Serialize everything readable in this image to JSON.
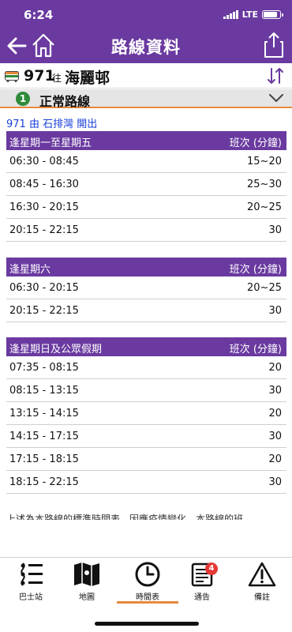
{
  "status_bar": {
    "time": "6:24",
    "network": "LTE"
  },
  "header": {
    "title": "路線資料"
  },
  "route": {
    "number": "971",
    "direction_word": "往",
    "destination": "海麗邨"
  },
  "variant": {
    "number": "1",
    "label": "正常路線"
  },
  "departure": {
    "text": "971 由 石排灣 開出"
  },
  "timetables": [
    {
      "day": "逢星期一至星期五",
      "freq_header": "班次 (分鐘)",
      "rows": [
        {
          "period": "06:30 - 08:45",
          "freq": "15~20"
        },
        {
          "period": "08:45 - 16:30",
          "freq": "25~30"
        },
        {
          "period": "16:30 - 20:15",
          "freq": "20~25"
        },
        {
          "period": "20:15 - 22:15",
          "freq": "30"
        }
      ]
    },
    {
      "day": "逢星期六",
      "freq_header": "班次 (分鐘)",
      "rows": [
        {
          "period": "06:30 - 20:15",
          "freq": "20~25"
        },
        {
          "period": "20:15 - 22:15",
          "freq": "30"
        }
      ]
    },
    {
      "day": "逢星期日及公眾假期",
      "freq_header": "班次 (分鐘)",
      "rows": [
        {
          "period": "07:35 - 08:15",
          "freq": "20"
        },
        {
          "period": "08:15 - 13:15",
          "freq": "30"
        },
        {
          "period": "13:15 - 14:15",
          "freq": "20"
        },
        {
          "period": "14:15 - 17:15",
          "freq": "30"
        },
        {
          "period": "17:15 - 18:15",
          "freq": "20"
        },
        {
          "period": "18:15 - 22:15",
          "freq": "30"
        }
      ]
    }
  ],
  "note": "上述為本路線的標準時間表。因應疫情變化，本路線的班",
  "tabs": [
    {
      "label": "巴士站",
      "icon": "stops-icon"
    },
    {
      "label": "地圖",
      "icon": "map-icon"
    },
    {
      "label": "時間表",
      "icon": "clock-icon",
      "active": true
    },
    {
      "label": "通告",
      "icon": "notice-icon",
      "badge": "4"
    },
    {
      "label": "備註",
      "icon": "warning-icon"
    }
  ],
  "colors": {
    "header": "#6a3aa0",
    "accent": "#e8893c",
    "badge": "#e53935",
    "variant": "#2e8b3a",
    "link": "#1a3fd8"
  }
}
